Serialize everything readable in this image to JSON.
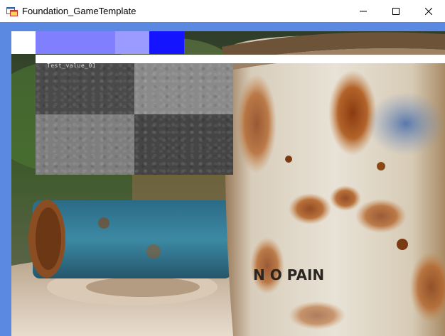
{
  "window": {
    "title": "Foundation_GameTemplate",
    "icon": "app-window-icon",
    "controls": {
      "minimize": "minimize-icon",
      "maximize": "maximize-icon",
      "close": "close-icon"
    }
  },
  "overlay": {
    "debug_text": "Test_value_01",
    "swatch_colors": [
      "#ffffff",
      "#8080ff",
      "#9a9aff",
      "#1414ff"
    ]
  },
  "scene": {
    "background_image": "rusty-barrel-photo",
    "barrel_stencil_text": "N O  PAIN"
  },
  "colors": {
    "client_background": "#5b88e0",
    "titlebar": "#ffffff"
  }
}
